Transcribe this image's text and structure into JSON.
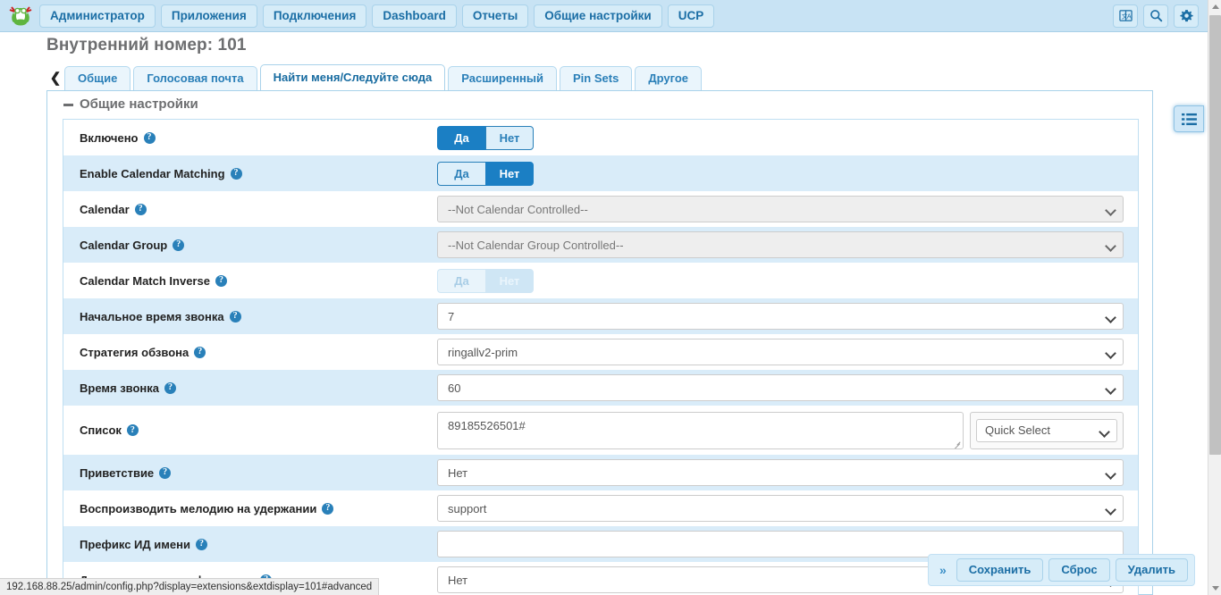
{
  "navbar": {
    "logo_icon": "freepbx-frog-logo",
    "items": [
      {
        "label": "Администратор",
        "name": "nav-administrator"
      },
      {
        "label": "Приложения",
        "name": "nav-applications"
      },
      {
        "label": "Подключения",
        "name": "nav-connections"
      },
      {
        "label": "Dashboard",
        "name": "nav-dashboard"
      },
      {
        "label": "Отчеты",
        "name": "nav-reports"
      },
      {
        "label": "Общие настройки",
        "name": "nav-general-settings"
      },
      {
        "label": "UCP",
        "name": "nav-ucp"
      }
    ],
    "icons": [
      {
        "name": "translate-icon"
      },
      {
        "name": "search-icon"
      },
      {
        "name": "gear-icon"
      }
    ]
  },
  "page": {
    "title": "Внутренний номер: 101"
  },
  "tabs": {
    "back_arrow": "❮",
    "items": [
      {
        "label": "Общие",
        "name": "tab-general",
        "active": false
      },
      {
        "label": "Голосовая почта",
        "name": "tab-voicemail",
        "active": false
      },
      {
        "label": "Найти меня/Следуйте сюда",
        "name": "tab-findme-followme",
        "active": true
      },
      {
        "label": "Расширенный",
        "name": "tab-advanced",
        "active": false
      },
      {
        "label": "Pin Sets",
        "name": "tab-pin-sets",
        "active": false
      },
      {
        "label": "Другое",
        "name": "tab-other",
        "active": false
      }
    ]
  },
  "section": {
    "title": "Общие настройки",
    "help_glyph": "?"
  },
  "rows": [
    {
      "label": "Включено",
      "name": "row-enabled",
      "type": "toggle",
      "options": [
        "Да",
        "Нет"
      ],
      "selected": "Да",
      "disabled": false,
      "alt": false
    },
    {
      "label": "Enable Calendar Matching",
      "name": "row-enable-calendar-matching",
      "type": "toggle",
      "options": [
        "Да",
        "Нет"
      ],
      "selected": "Нет",
      "disabled": false,
      "alt": true
    },
    {
      "label": "Calendar",
      "name": "row-calendar",
      "type": "select",
      "value": "--Not Calendar Controlled--",
      "disabled": true,
      "alt": false
    },
    {
      "label": "Calendar Group",
      "name": "row-calendar-group",
      "type": "select",
      "value": "--Not Calendar Group Controlled--",
      "disabled": true,
      "alt": true
    },
    {
      "label": "Calendar Match Inverse",
      "name": "row-calendar-match-inverse",
      "type": "toggle",
      "options": [
        "Да",
        "Нет"
      ],
      "selected": "Нет",
      "disabled": true,
      "alt": false
    },
    {
      "label": "Начальное время звонка",
      "name": "row-initial-ring-time",
      "type": "select",
      "value": "7",
      "disabled": false,
      "alt": true
    },
    {
      "label": "Стратегия обзвона",
      "name": "row-ring-strategy",
      "type": "select",
      "value": "ringallv2-prim",
      "disabled": false,
      "alt": false
    },
    {
      "label": "Время звонка",
      "name": "row-ring-time",
      "type": "select",
      "value": "60",
      "disabled": false,
      "alt": true
    },
    {
      "label": "Список",
      "name": "row-followme-list",
      "type": "textarea",
      "value": "89185526501#",
      "quick_select": "Quick Select",
      "disabled": false,
      "alt": false
    },
    {
      "label": "Приветствие",
      "name": "row-announcement",
      "type": "select",
      "value": "Нет",
      "disabled": false,
      "alt": true
    },
    {
      "label": "Воспроизводить мелодию на удержании",
      "name": "row-play-music-on-hold",
      "type": "select",
      "value": "support",
      "disabled": false,
      "alt": false
    },
    {
      "label": "Префикс ИД имени",
      "name": "row-cid-name-prefix",
      "type": "text",
      "value": "",
      "disabled": false,
      "alt": true
    },
    {
      "label": "Дополнительная информация",
      "name": "row-alert-info",
      "type": "select",
      "value": "Нет",
      "disabled": false,
      "alt": false
    }
  ],
  "side_panel": {
    "toggle_icon": "list-panel-icon"
  },
  "action_bar": {
    "expand_glyph": "»",
    "buttons": [
      {
        "label": "Сохранить",
        "name": "save-button"
      },
      {
        "label": "Сброс",
        "name": "reset-button"
      },
      {
        "label": "Удалить",
        "name": "delete-button"
      }
    ]
  },
  "statusbar": {
    "url": "192.168.88.25/admin/config.php?display=extensions&extdisplay=101#advanced"
  },
  "colors": {
    "accent": "#1b7fc4",
    "nav_bg": "#c8e3f4",
    "row_alt": "#d9ecf9",
    "link": "#2a7fb8"
  }
}
